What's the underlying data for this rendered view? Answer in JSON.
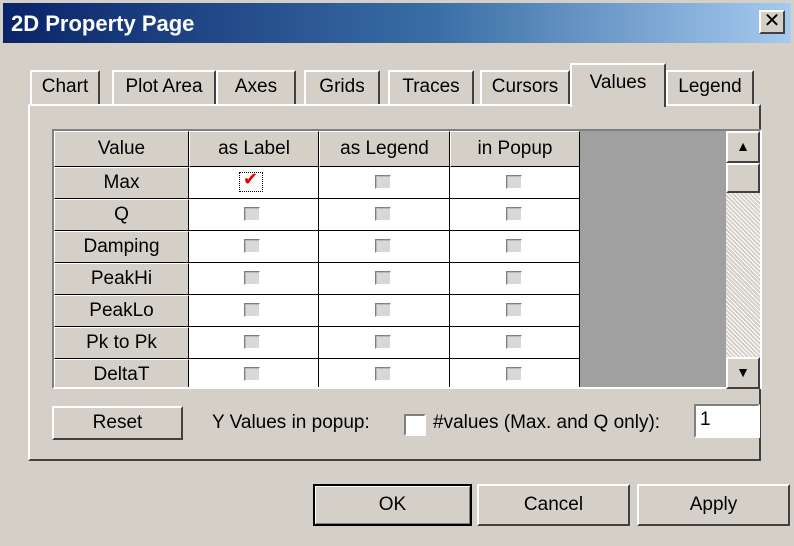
{
  "window": {
    "title": "2D Property Page",
    "close_glyph": "✕"
  },
  "tabs": [
    {
      "label": "Chart",
      "active": false
    },
    {
      "label": "Plot Area",
      "active": false
    },
    {
      "label": "Axes",
      "active": false
    },
    {
      "label": "Grids",
      "active": false
    },
    {
      "label": "Traces",
      "active": false
    },
    {
      "label": "Cursors",
      "active": false
    },
    {
      "label": "Values",
      "active": true
    },
    {
      "label": "Legend",
      "active": false
    }
  ],
  "grid": {
    "columns": [
      "Value",
      "as Label",
      "as Legend",
      "in Popup"
    ],
    "rows": [
      {
        "name": "Max",
        "as_label": true,
        "as_legend": false,
        "in_popup": false
      },
      {
        "name": "Q",
        "as_label": false,
        "as_legend": false,
        "in_popup": false
      },
      {
        "name": "Damping",
        "as_label": false,
        "as_legend": false,
        "in_popup": false
      },
      {
        "name": "PeakHi",
        "as_label": false,
        "as_legend": false,
        "in_popup": false
      },
      {
        "name": "PeakLo",
        "as_label": false,
        "as_legend": false,
        "in_popup": false
      },
      {
        "name": "Pk to Pk",
        "as_label": false,
        "as_legend": false,
        "in_popup": false
      },
      {
        "name": "DeltaT",
        "as_label": false,
        "as_legend": false,
        "in_popup": false
      }
    ],
    "scroll_up_glyph": "▲",
    "scroll_down_glyph": "▼"
  },
  "controls": {
    "reset_label": "Reset",
    "y_values_label": "Y Values in popup:",
    "values_count_label": "#values (Max. and Q only):",
    "values_count_value": "1"
  },
  "footer": {
    "ok_label": "OK",
    "cancel_label": "Cancel",
    "apply_label": "Apply"
  },
  "colors": {
    "titlebar_start": "#0a246a",
    "titlebar_end": "#a6caf0",
    "face": "#d4d0c8",
    "check_mark": "#e00000"
  }
}
